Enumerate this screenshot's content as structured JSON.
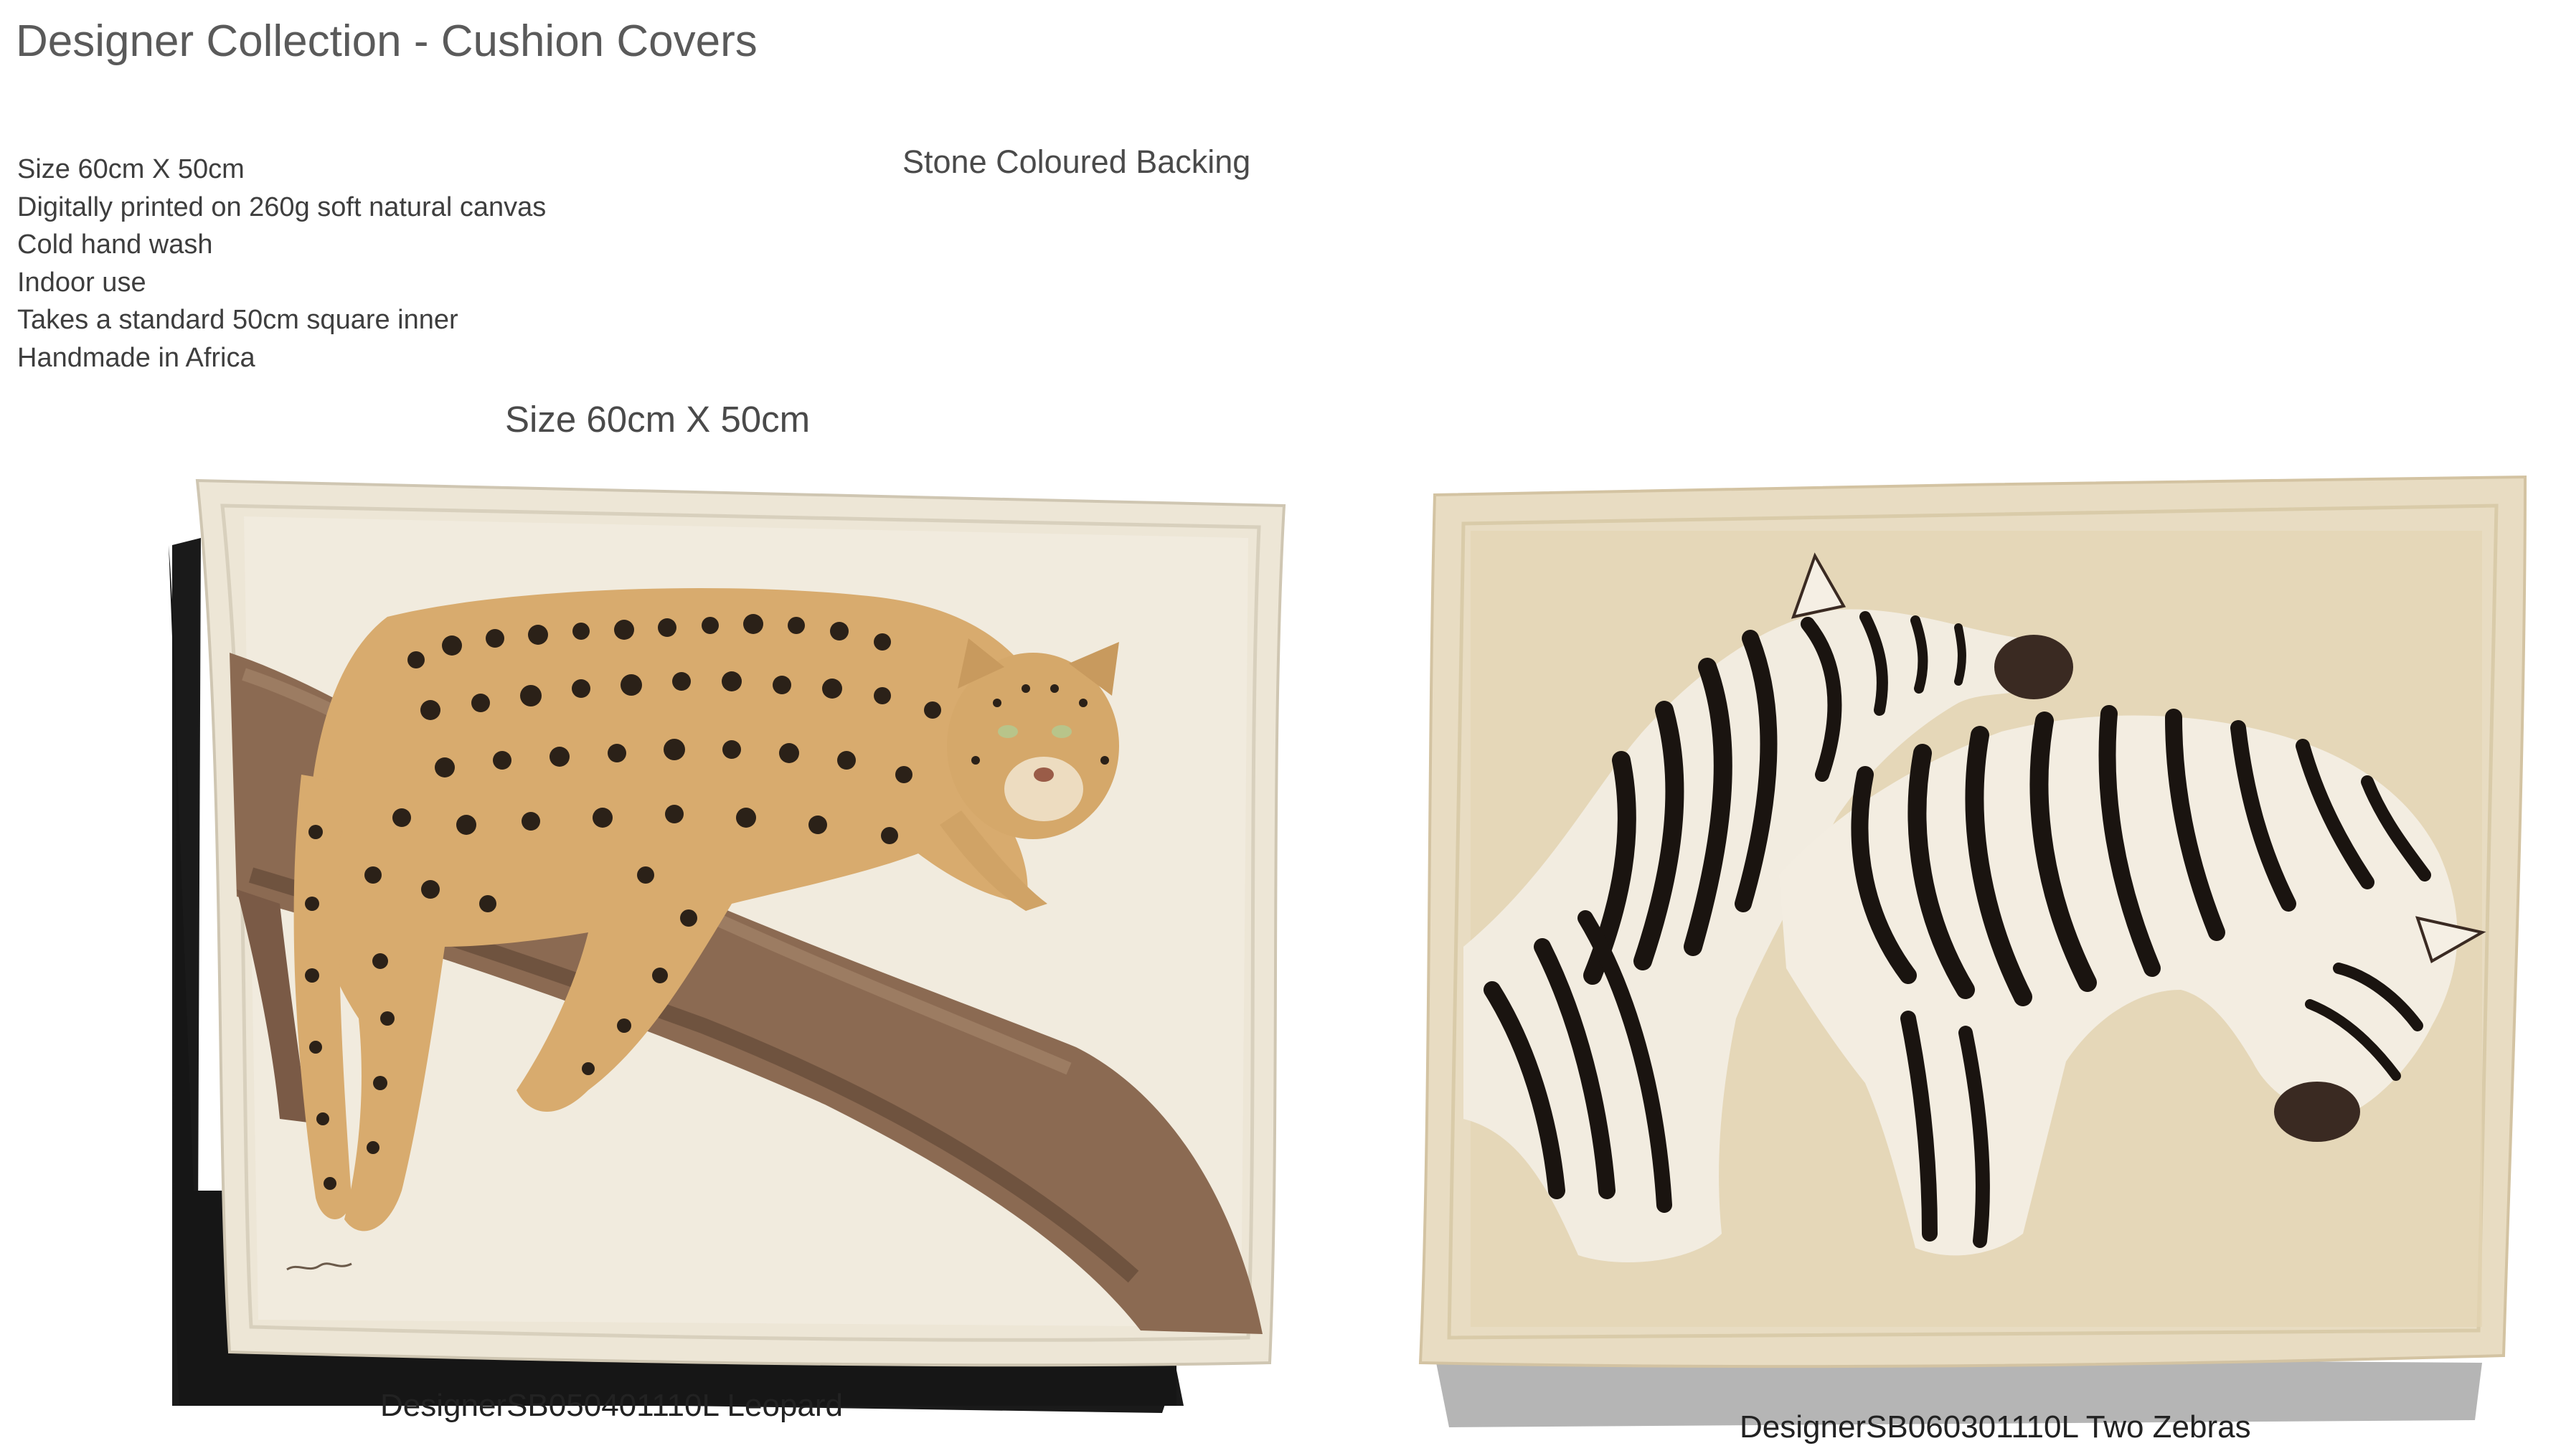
{
  "page": {
    "title": "Designer Collection - Cushion Covers",
    "backing_note": "Stone Coloured Backing",
    "size_note": "Size 60cm X 50cm"
  },
  "specs": [
    "Size 60cm X 50cm",
    "Digitally printed on 260g soft natural canvas",
    "Cold hand wash",
    "Indoor use",
    "Takes a standard 50cm square inner",
    "Handmade in Africa"
  ],
  "products": [
    {
      "caption": "DesignerSB050401110L Leopard",
      "image": "leopard-on-branch-cushion-photo"
    },
    {
      "caption": "DesignerSB060301110L Two Zebras",
      "image": "two-zebras-cushion-photo"
    }
  ],
  "colors": {
    "canvas_cream": "#ece6d8",
    "backing_stone": "#e8dcc2",
    "branch_brown": "#8a6a52",
    "leopard_tan": "#d9ab6c"
  }
}
